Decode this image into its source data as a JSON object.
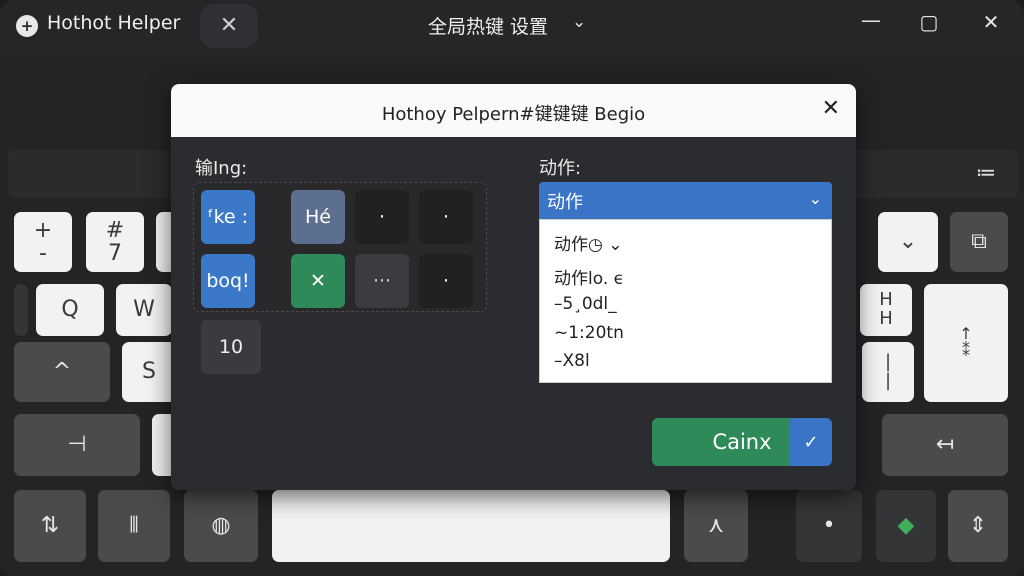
{
  "titlebar": {
    "app_name": "Hothot Helper",
    "app_icon": "+",
    "tab_close": "✕",
    "center_title": "全局热键 设置",
    "center_chevron": "⌄",
    "minimize": "—",
    "maximize": "▢",
    "close": "✕"
  },
  "toolbar": {
    "list_icon": "≔"
  },
  "keyboard": {
    "r1": [
      {
        "t": "+",
        "b": "-"
      },
      {
        "t": "#",
        "b": "7"
      },
      {
        "t": "",
        "b": ""
      },
      {
        "t": "⌄",
        "b": ""
      },
      {
        "t": "⧉",
        "b": ""
      }
    ],
    "r2": [
      {
        "t": "Q"
      },
      {
        "t": "W"
      },
      {
        "t": "H",
        "b": "H"
      },
      {
        "t": "↑",
        "b": "⁑"
      }
    ],
    "r3": [
      {
        "t": "^"
      },
      {
        "t": "S"
      },
      {
        "t": "|",
        "b": "|"
      }
    ],
    "r4": [
      {
        "t": "⊣"
      },
      {
        "t": "↤"
      }
    ],
    "r5": [
      {
        "t": "⇅"
      },
      {
        "t": "⦀"
      },
      {
        "t": "◍"
      },
      {
        "t": ""
      },
      {
        "t": "⋏"
      },
      {
        "t": "•"
      },
      {
        "t": "◆"
      },
      {
        "t": "⇕"
      }
    ]
  },
  "dialog": {
    "title": "Hothoy Pelpern#键键键 Begio",
    "close": "✕",
    "input_label": "输Ing:",
    "action_label": "动作:",
    "cells": [
      "ᶠke :",
      "Hé",
      "·",
      "·",
      "boq!",
      "✕",
      "···",
      "·",
      "10"
    ],
    "select_value": "动作",
    "select_chevron": "⌄",
    "options": [
      "动作◷ ⌄",
      "动作lo.  ϵ",
      "–5¸0dl_",
      "~1:20tn",
      "–X8l"
    ],
    "cancel_label": "Cainx",
    "confirm_label": "✓"
  },
  "colors": {
    "accent_blue": "#3a74c6",
    "accent_green": "#2e8a58",
    "window_bg": "#232426"
  }
}
